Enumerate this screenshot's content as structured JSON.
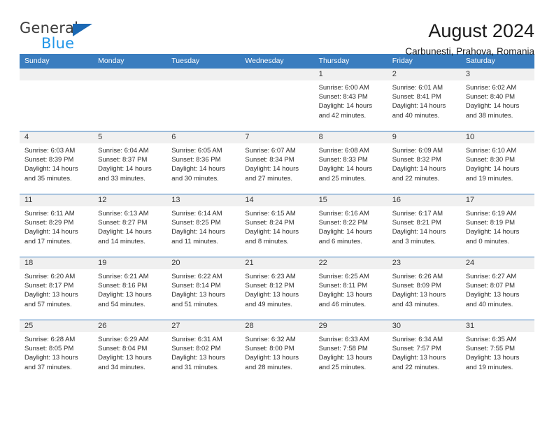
{
  "brand": {
    "name_top": "General",
    "name_bottom": "Blue"
  },
  "header": {
    "title": "August 2024",
    "subtitle": "Carbunesti, Prahova, Romania"
  },
  "colors": {
    "header_blue": "#3a7dbf",
    "brand_blue": "#2196e8",
    "logo_triangle": "#1b68b3",
    "day_band": "#f0f0f0"
  },
  "labels": {
    "sunrise": "Sunrise:",
    "sunset": "Sunset:",
    "daylight": "Daylight:"
  },
  "weekdays": [
    "Sunday",
    "Monday",
    "Tuesday",
    "Wednesday",
    "Thursday",
    "Friday",
    "Saturday"
  ],
  "weeks": [
    [
      {
        "empty": true
      },
      {
        "empty": true
      },
      {
        "empty": true
      },
      {
        "empty": true
      },
      {
        "day": "1",
        "sunrise": "Sunrise: 6:00 AM",
        "sunset": "Sunset: 8:43 PM",
        "daylight_1": "Daylight: 14 hours",
        "daylight_2": "and 42 minutes."
      },
      {
        "day": "2",
        "sunrise": "Sunrise: 6:01 AM",
        "sunset": "Sunset: 8:41 PM",
        "daylight_1": "Daylight: 14 hours",
        "daylight_2": "and 40 minutes."
      },
      {
        "day": "3",
        "sunrise": "Sunrise: 6:02 AM",
        "sunset": "Sunset: 8:40 PM",
        "daylight_1": "Daylight: 14 hours",
        "daylight_2": "and 38 minutes."
      }
    ],
    [
      {
        "day": "4",
        "sunrise": "Sunrise: 6:03 AM",
        "sunset": "Sunset: 8:39 PM",
        "daylight_1": "Daylight: 14 hours",
        "daylight_2": "and 35 minutes."
      },
      {
        "day": "5",
        "sunrise": "Sunrise: 6:04 AM",
        "sunset": "Sunset: 8:37 PM",
        "daylight_1": "Daylight: 14 hours",
        "daylight_2": "and 33 minutes."
      },
      {
        "day": "6",
        "sunrise": "Sunrise: 6:05 AM",
        "sunset": "Sunset: 8:36 PM",
        "daylight_1": "Daylight: 14 hours",
        "daylight_2": "and 30 minutes."
      },
      {
        "day": "7",
        "sunrise": "Sunrise: 6:07 AM",
        "sunset": "Sunset: 8:34 PM",
        "daylight_1": "Daylight: 14 hours",
        "daylight_2": "and 27 minutes."
      },
      {
        "day": "8",
        "sunrise": "Sunrise: 6:08 AM",
        "sunset": "Sunset: 8:33 PM",
        "daylight_1": "Daylight: 14 hours",
        "daylight_2": "and 25 minutes."
      },
      {
        "day": "9",
        "sunrise": "Sunrise: 6:09 AM",
        "sunset": "Sunset: 8:32 PM",
        "daylight_1": "Daylight: 14 hours",
        "daylight_2": "and 22 minutes."
      },
      {
        "day": "10",
        "sunrise": "Sunrise: 6:10 AM",
        "sunset": "Sunset: 8:30 PM",
        "daylight_1": "Daylight: 14 hours",
        "daylight_2": "and 19 minutes."
      }
    ],
    [
      {
        "day": "11",
        "sunrise": "Sunrise: 6:11 AM",
        "sunset": "Sunset: 8:29 PM",
        "daylight_1": "Daylight: 14 hours",
        "daylight_2": "and 17 minutes."
      },
      {
        "day": "12",
        "sunrise": "Sunrise: 6:13 AM",
        "sunset": "Sunset: 8:27 PM",
        "daylight_1": "Daylight: 14 hours",
        "daylight_2": "and 14 minutes."
      },
      {
        "day": "13",
        "sunrise": "Sunrise: 6:14 AM",
        "sunset": "Sunset: 8:25 PM",
        "daylight_1": "Daylight: 14 hours",
        "daylight_2": "and 11 minutes."
      },
      {
        "day": "14",
        "sunrise": "Sunrise: 6:15 AM",
        "sunset": "Sunset: 8:24 PM",
        "daylight_1": "Daylight: 14 hours",
        "daylight_2": "and 8 minutes."
      },
      {
        "day": "15",
        "sunrise": "Sunrise: 6:16 AM",
        "sunset": "Sunset: 8:22 PM",
        "daylight_1": "Daylight: 14 hours",
        "daylight_2": "and 6 minutes."
      },
      {
        "day": "16",
        "sunrise": "Sunrise: 6:17 AM",
        "sunset": "Sunset: 8:21 PM",
        "daylight_1": "Daylight: 14 hours",
        "daylight_2": "and 3 minutes."
      },
      {
        "day": "17",
        "sunrise": "Sunrise: 6:19 AM",
        "sunset": "Sunset: 8:19 PM",
        "daylight_1": "Daylight: 14 hours",
        "daylight_2": "and 0 minutes."
      }
    ],
    [
      {
        "day": "18",
        "sunrise": "Sunrise: 6:20 AM",
        "sunset": "Sunset: 8:17 PM",
        "daylight_1": "Daylight: 13 hours",
        "daylight_2": "and 57 minutes."
      },
      {
        "day": "19",
        "sunrise": "Sunrise: 6:21 AM",
        "sunset": "Sunset: 8:16 PM",
        "daylight_1": "Daylight: 13 hours",
        "daylight_2": "and 54 minutes."
      },
      {
        "day": "20",
        "sunrise": "Sunrise: 6:22 AM",
        "sunset": "Sunset: 8:14 PM",
        "daylight_1": "Daylight: 13 hours",
        "daylight_2": "and 51 minutes."
      },
      {
        "day": "21",
        "sunrise": "Sunrise: 6:23 AM",
        "sunset": "Sunset: 8:12 PM",
        "daylight_1": "Daylight: 13 hours",
        "daylight_2": "and 49 minutes."
      },
      {
        "day": "22",
        "sunrise": "Sunrise: 6:25 AM",
        "sunset": "Sunset: 8:11 PM",
        "daylight_1": "Daylight: 13 hours",
        "daylight_2": "and 46 minutes."
      },
      {
        "day": "23",
        "sunrise": "Sunrise: 6:26 AM",
        "sunset": "Sunset: 8:09 PM",
        "daylight_1": "Daylight: 13 hours",
        "daylight_2": "and 43 minutes."
      },
      {
        "day": "24",
        "sunrise": "Sunrise: 6:27 AM",
        "sunset": "Sunset: 8:07 PM",
        "daylight_1": "Daylight: 13 hours",
        "daylight_2": "and 40 minutes."
      }
    ],
    [
      {
        "day": "25",
        "sunrise": "Sunrise: 6:28 AM",
        "sunset": "Sunset: 8:05 PM",
        "daylight_1": "Daylight: 13 hours",
        "daylight_2": "and 37 minutes."
      },
      {
        "day": "26",
        "sunrise": "Sunrise: 6:29 AM",
        "sunset": "Sunset: 8:04 PM",
        "daylight_1": "Daylight: 13 hours",
        "daylight_2": "and 34 minutes."
      },
      {
        "day": "27",
        "sunrise": "Sunrise: 6:31 AM",
        "sunset": "Sunset: 8:02 PM",
        "daylight_1": "Daylight: 13 hours",
        "daylight_2": "and 31 minutes."
      },
      {
        "day": "28",
        "sunrise": "Sunrise: 6:32 AM",
        "sunset": "Sunset: 8:00 PM",
        "daylight_1": "Daylight: 13 hours",
        "daylight_2": "and 28 minutes."
      },
      {
        "day": "29",
        "sunrise": "Sunrise: 6:33 AM",
        "sunset": "Sunset: 7:58 PM",
        "daylight_1": "Daylight: 13 hours",
        "daylight_2": "and 25 minutes."
      },
      {
        "day": "30",
        "sunrise": "Sunrise: 6:34 AM",
        "sunset": "Sunset: 7:57 PM",
        "daylight_1": "Daylight: 13 hours",
        "daylight_2": "and 22 minutes."
      },
      {
        "day": "31",
        "sunrise": "Sunrise: 6:35 AM",
        "sunset": "Sunset: 7:55 PM",
        "daylight_1": "Daylight: 13 hours",
        "daylight_2": "and 19 minutes."
      }
    ]
  ]
}
